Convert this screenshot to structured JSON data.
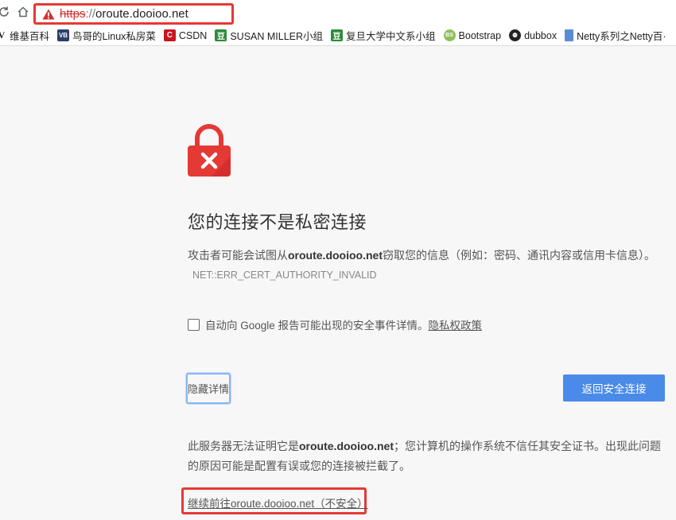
{
  "address_bar": {
    "scheme": "https",
    "separator": "://",
    "host": "oroute.dooioo.net"
  },
  "bookmarks": [
    {
      "label": "维基百科",
      "icon": "wikipedia-icon"
    },
    {
      "label": "鸟哥的Linux私房菜",
      "icon": "vbird-icon"
    },
    {
      "label": "CSDN",
      "icon": "csdn-icon"
    },
    {
      "label": "SUSAN MILLER小组",
      "icon": "douban-icon"
    },
    {
      "label": "复旦大学中文系小组",
      "icon": "douban-icon"
    },
    {
      "label": "Bootstrap",
      "icon": "bootstrap-icon"
    },
    {
      "label": "dubbox",
      "icon": "github-icon"
    },
    {
      "label": "Netty系列之Netty百·",
      "icon": "document-icon"
    }
  ],
  "page": {
    "title": "您的连接不是私密连接",
    "desc_before": "攻击者可能会试图从",
    "desc_host": "oroute.dooioo.net",
    "desc_after": "窃取您的信息（例如：密码、通讯内容或信用卡信息）。",
    "error_code": "NET::ERR_CERT_AUTHORITY_INVALID",
    "report_label": "自动向 Google 报告可能出现的安全事件详情。",
    "privacy_link": "隐私权政策",
    "hide_details": "隐藏详情",
    "back_button": "返回安全连接",
    "details_before": "此服务器无法证明它是",
    "details_host": "oroute.dooioo.net",
    "details_after": "；您计算机的操作系统不信任其安全证书。出现此问题的原因可能是配置有误或您的连接被拦截了。",
    "proceed_link": "继续前往oroute.dooioo.net（不安全）"
  },
  "colors": {
    "lock_red": "#e53935",
    "accent_blue": "#4a8ae8",
    "highlight_red": "#e53935"
  }
}
